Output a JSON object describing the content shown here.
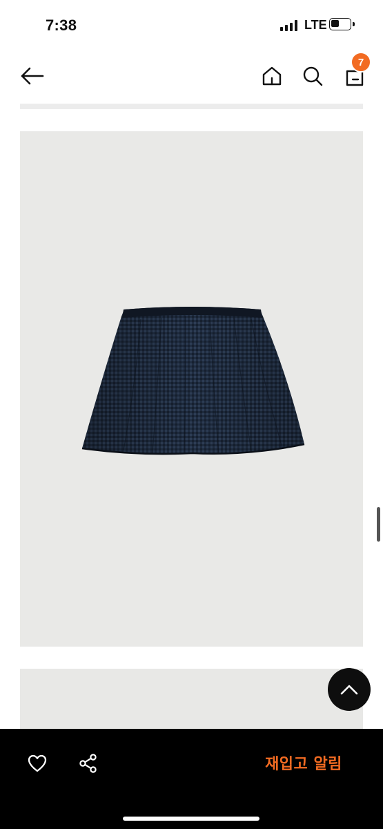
{
  "status_bar": {
    "time": "7:38",
    "network": "LTE"
  },
  "header": {
    "cart_count": "7"
  },
  "product": {
    "image_1_icon": "skirt-image",
    "image_2_icon": "product-image-partial"
  },
  "actions": {
    "restock_label": "재입고 알림",
    "wishlist_icon": "heart-icon",
    "share_icon": "share-icon",
    "scroll_top_icon": "chevron-up-icon"
  },
  "colors": {
    "accent": "#f26b22",
    "bottom_bar": "#000000",
    "image_bg": "#e9e9e7",
    "skirt": "#1d2a3e"
  }
}
